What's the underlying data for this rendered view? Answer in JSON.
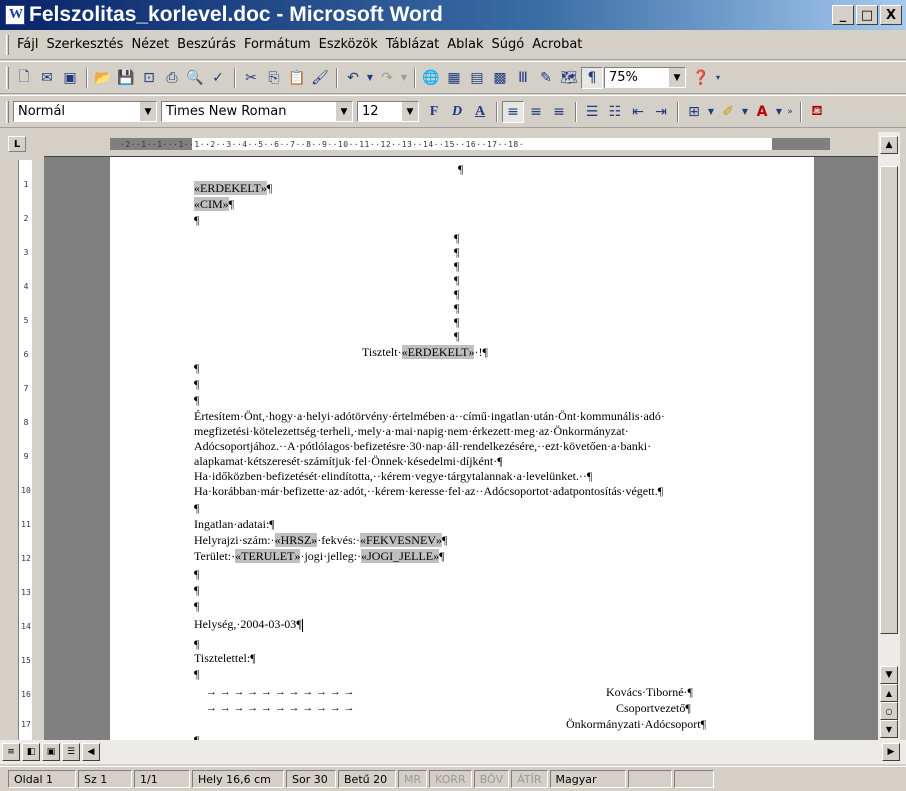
{
  "window": {
    "title": "Felszolitas_korlevel.doc - Microsoft Word",
    "minimize": "_",
    "maximize": "□",
    "close": "X"
  },
  "menu": [
    "Fájl",
    "Szerkesztés",
    "Nézet",
    "Beszúrás",
    "Formátum",
    "Eszközök",
    "Táblázat",
    "Ablak",
    "Súgó",
    "Acrobat"
  ],
  "toolbar": {
    "zoom": "75%",
    "style": "Normál",
    "font": "Times New Roman",
    "size": "12",
    "bold": "F",
    "italic": "D",
    "underline": "A"
  },
  "ruler": {
    "marks": "·2··1··1···1··1··2··3··4··5··6··7··8··9··10··11··12··13··14··15··16··17··18·",
    "vmarks": [
      "1",
      "2",
      "3",
      "4",
      "5",
      "6",
      "7",
      "8",
      "9",
      "10",
      "11",
      "12",
      "13",
      "14",
      "15",
      "16",
      "17"
    ]
  },
  "document": {
    "top_mark": "¶",
    "field_erdekelt": "«ERDEKELT»",
    "field_cim": "«CIM»",
    "pilcrow": "¶",
    "salutation_pre": "Tisztelt·",
    "salutation_post": "·!¶",
    "body": [
      "Értesítem·Önt,·hogy·a·helyi·adótörvény·értelmében·a··című·ingatlan·után·Önt·kommunális·adó·",
      "megfizetési·kötelezettség·terheli,·mely·a·mai·napig·nem·érkezett·meg·az·Önkormányzat·",
      "Adócsoportjához.··A·pótlólagos·befizetésre·30·nap·áll·rendelkezésére,··ezt·követően·a·banki·",
      "alapkamat·kétszeresét·számítjuk·fel·Önnek·késedelmi·díjként·¶",
      "Ha·időközben·befizetését·elindította,··kérem·vegye·tárgytalannak·a·levelünket.··¶",
      "Ha·korábban·már·befizette·az·adót,··kérem·keresse·fel·az··Adócsoportot·adatpontosítás·végett.¶"
    ],
    "ingatlan_label": "Ingatlan·adatai:¶",
    "hrsz_label": "Helyrajzi·szám:·",
    "hrsz_field": "«HRSZ»",
    "fekves_label": "·fekvés:·",
    "fekves_field": "«FEKVESNEV»",
    "terulet_label": "Terület:·",
    "terulet_field": "«TERULET»",
    "jogi_label": "·jogi·jelleg:·",
    "jogi_field": "«JOGI_JELLE»",
    "date_line": "Helység,·2004-03-03",
    "closing": "Tisztelettel:¶",
    "tabs": "→   →   →   →   →   →   →   →   →   →   →",
    "sign_name": "Kovács·Tiborné·¶",
    "sign_title": "Csoportvezető¶",
    "sign_org": "Önkormányzati·Adócsoport¶"
  },
  "status": {
    "page": "Oldal 1",
    "section": "Sz 1",
    "pages": "1/1",
    "position": "Hely 16,6 cm",
    "line": "Sor 30",
    "column": "Betű 20",
    "mr": "MR",
    "korr": "KORR",
    "bov": "BŐV",
    "atir": "ÁTÍR",
    "language": "Magyar"
  }
}
